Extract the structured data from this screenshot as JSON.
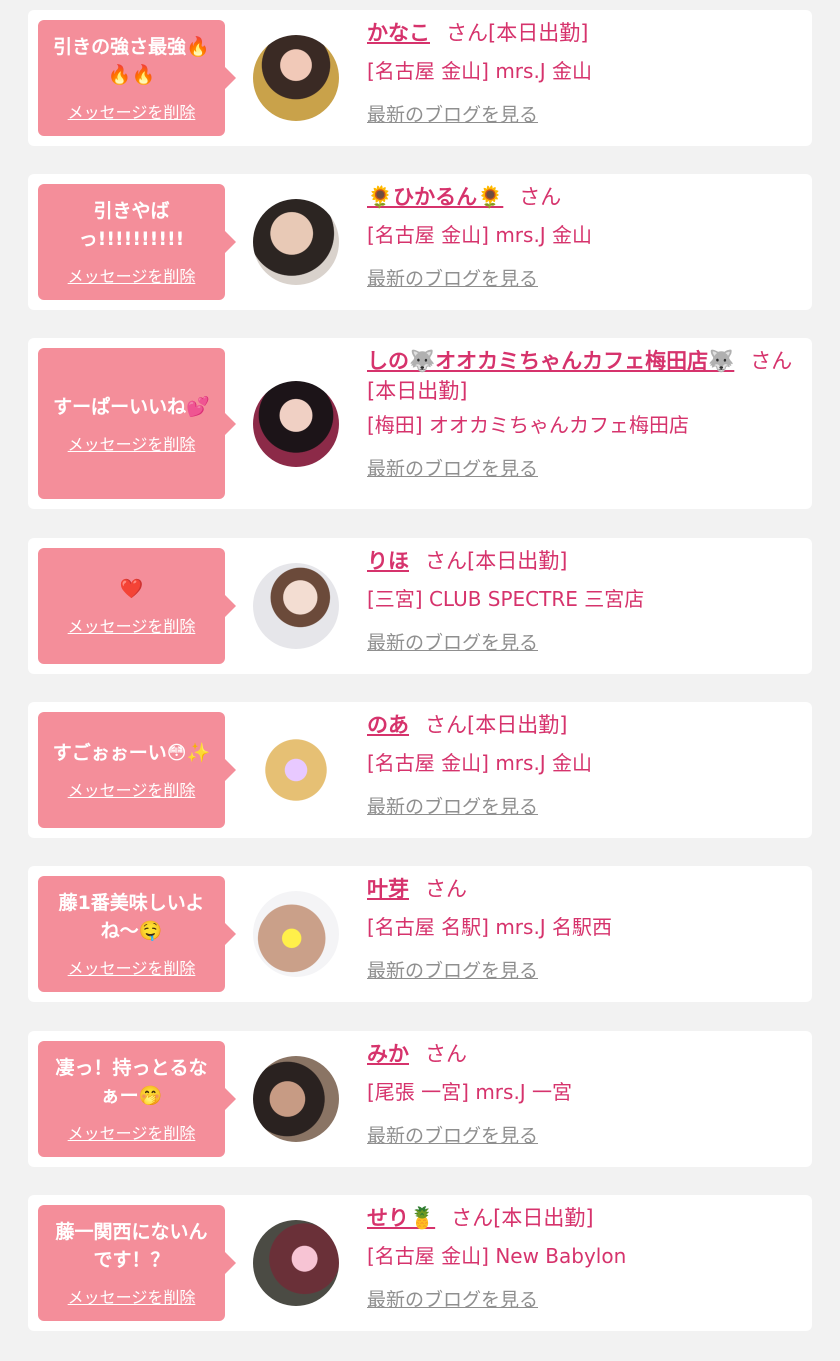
{
  "delete_label": "メッセージを削除",
  "blog_label": "最新のブログを見る",
  "accent_color": "#f48e9a",
  "name_color": "#d6336c",
  "messages": [
    {
      "text": "引きの強さ最強🔥🔥🔥",
      "name": "かなこ",
      "suffix": "さん[本日出勤]",
      "shop": "[名古屋 金山] mrs.J 金山",
      "avatar": "avatar-woman-icon"
    },
    {
      "text": "引きやばっ!!!!!!!!!!",
      "name": "🌻ひかるん🌻",
      "suffix": "さん",
      "shop": "[名古屋 金山] mrs.J 金山",
      "avatar": "avatar-woman-icon"
    },
    {
      "text": "すーぱーいいね💕",
      "name": "しの🐺オオカミちゃんカフェ梅田店🐺",
      "suffix": "さん[本日出勤]",
      "shop": "[梅田] オオカミちゃんカフェ梅田店",
      "avatar": "avatar-woman-icon"
    },
    {
      "text": "❤️",
      "name": "りほ",
      "suffix": "さん[本日出勤]",
      "shop": "[三宮] CLUB SPECTRE 三宮店",
      "avatar": "avatar-woman-icon"
    },
    {
      "text": "すごぉぉーい😳✨",
      "name": "のあ",
      "suffix": "さん[本日出勤]",
      "shop": "[名古屋 金山] mrs.J 金山",
      "avatar": "avatar-woman-icon"
    },
    {
      "text": "藤1番美味しいよね〜🤤",
      "name": "叶芽",
      "suffix": "さん",
      "shop": "[名古屋 名駅] mrs.J 名駅西",
      "avatar": "avatar-woman-icon"
    },
    {
      "text": "凄っ！持っとるなぁー🤭",
      "name": "みか",
      "suffix": "さん",
      "shop": "[尾張 一宮] mrs.J 一宮",
      "avatar": "avatar-woman-icon"
    },
    {
      "text": "藤一関西にないんです！？",
      "name": "せり🍍",
      "suffix": "さん[本日出勤]",
      "shop": "[名古屋 金山] New Babylon",
      "avatar": "avatar-woman-icon"
    }
  ]
}
